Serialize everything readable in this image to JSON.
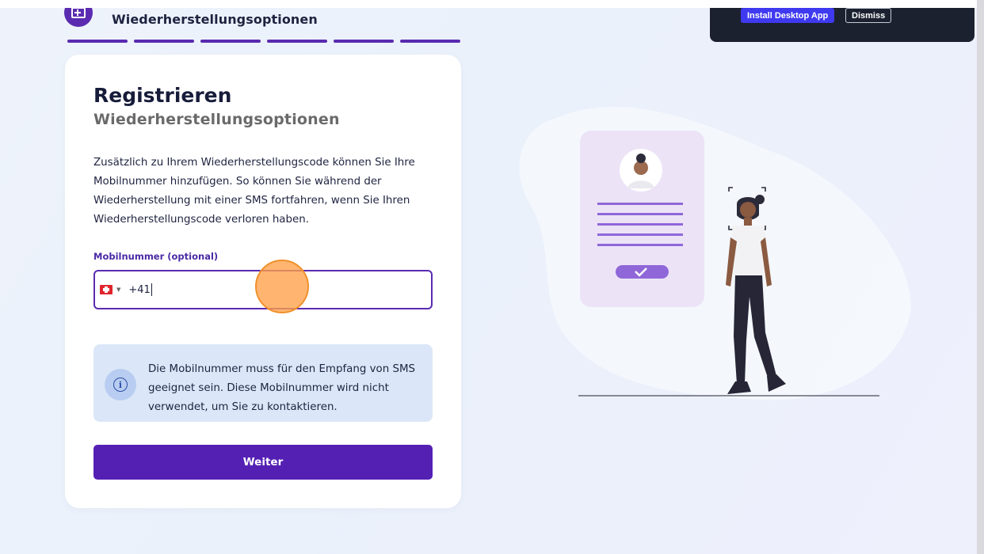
{
  "header": {
    "title": "Wiederherstellungsoptionen",
    "progress_steps": 6
  },
  "toast": {
    "install_label": "Install Desktop App",
    "dismiss_label": "Dismiss"
  },
  "card": {
    "title": "Registrieren",
    "subtitle": "Wiederherstellungsoptionen",
    "description": "Zusätzlich zu Ihrem Wiederherstellungscode können Sie Ihre Mobilnummer hinzufügen. So können Sie während der Wiederherstellung mit einer SMS fortfahren, wenn Sie Ihren Wiederherstellungscode verloren haben.",
    "phone_field": {
      "label": "Mobilnummer (optional)",
      "value": "+41",
      "country": "CH"
    },
    "info": {
      "text": "Die Mobilnummer muss für den Empfang von SMS geeignet sein. Diese Mobilnummer wird nicht verwendet, um Sie zu kontaktieren.",
      "icon": "info-icon"
    },
    "next_button_label": "Weiter"
  },
  "colors": {
    "primary": "#5420b4",
    "info_bg": "#dbe7f8",
    "toast_bg": "#1c2130",
    "click_indicator": "#ffa048"
  }
}
